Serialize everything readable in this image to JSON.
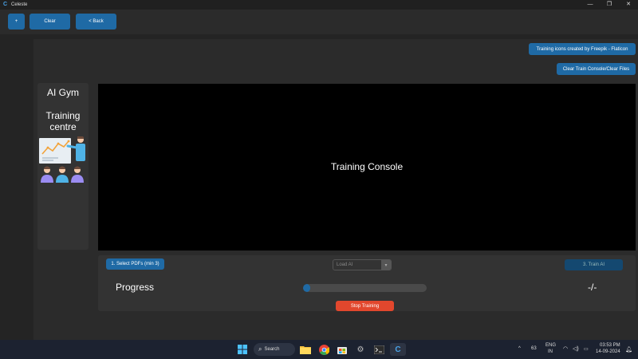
{
  "window": {
    "title": "Celeste",
    "app_icon": "C",
    "controls": {
      "minimize": "—",
      "maximize": "❐",
      "close": "✕"
    }
  },
  "topbar": {
    "add_label": "+",
    "clear_label": "Clear",
    "back_label": "< Back"
  },
  "credit_label": "Training icons created by Freepik - Flaticon",
  "clear_console_label": "Clear Train Console/Clear Files",
  "sidebar": {
    "gym_title": "AI Gym",
    "training_title": "Training\ncentre"
  },
  "console": {
    "label": "Training Console"
  },
  "controls": {
    "select_pdfs_label": "1. Select PDFs (min 3)",
    "load_ai_placeholder": "Load AI",
    "train_ai_label": "3. Train AI",
    "progress_label": "Progress",
    "progress_value": "-/-",
    "progress_fraction": 0.05,
    "stop_label": "Stop Training"
  },
  "taskbar": {
    "search_label": "Search",
    "tray_up": "^",
    "temperature": "63",
    "lang_top": "ENG",
    "lang_bottom": "IN",
    "time": "03:53 PM",
    "date": "14-09-2024"
  },
  "colors": {
    "accent": "#1f6aa5",
    "stop": "#e2472d",
    "console_bg": "#000000"
  }
}
